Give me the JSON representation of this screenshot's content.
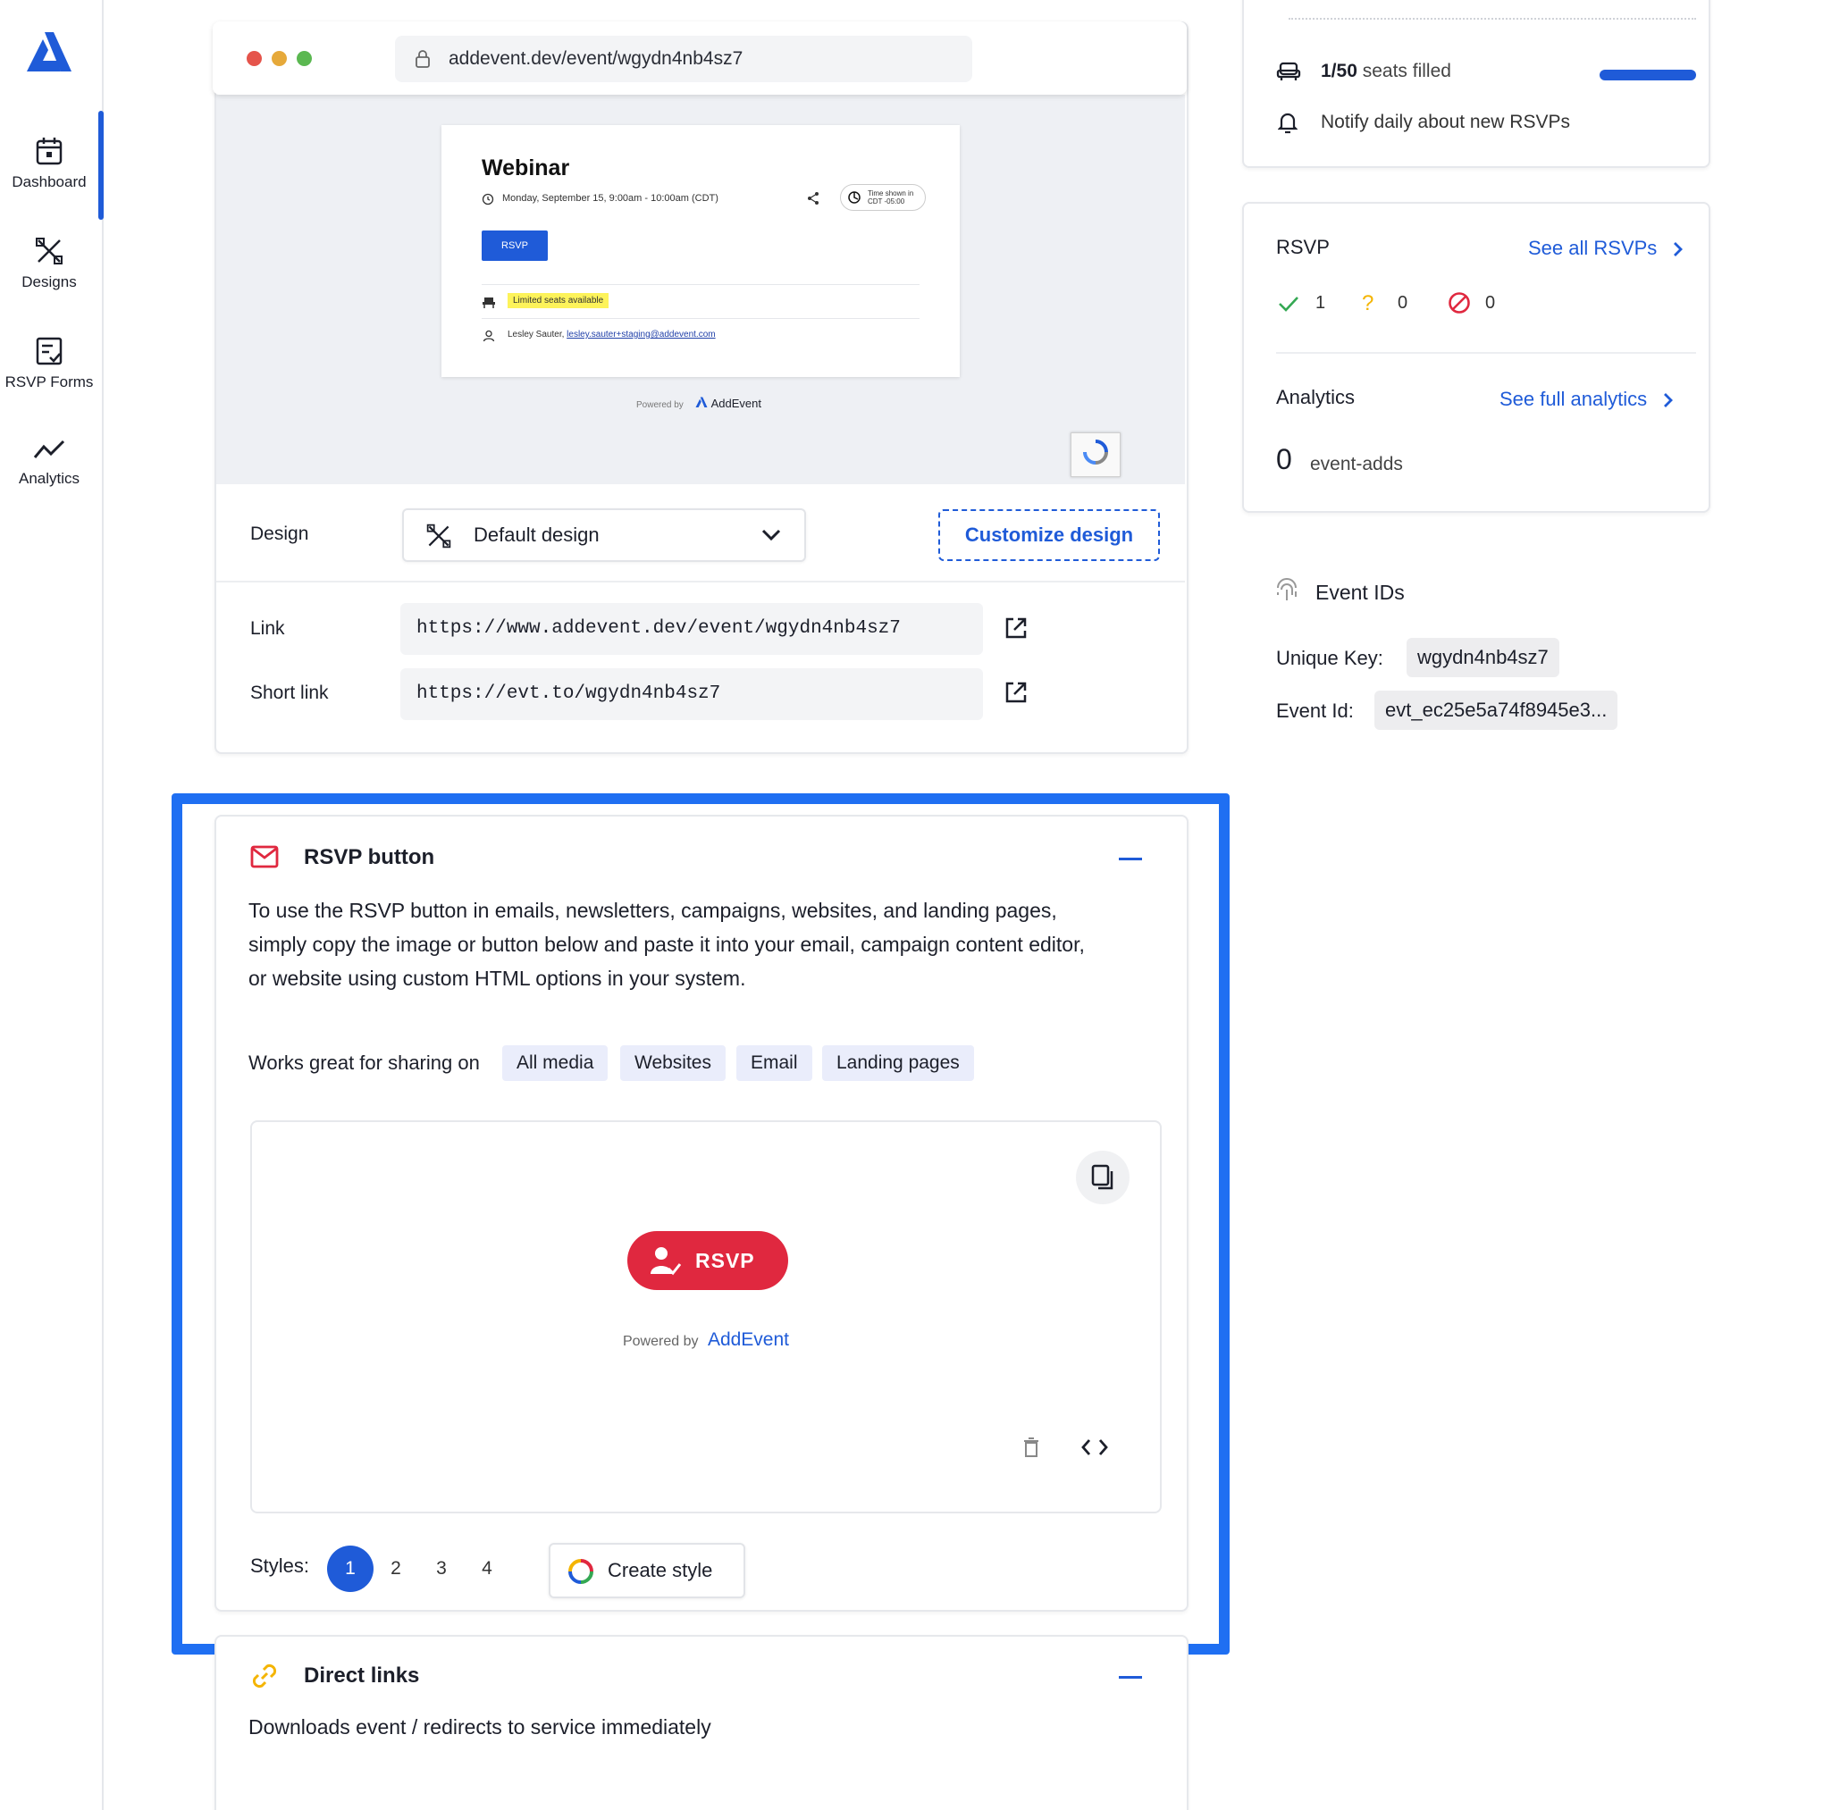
{
  "sidebar": {
    "items": [
      {
        "label": "Dashboard",
        "icon": "calendar-icon"
      },
      {
        "label": "Designs",
        "icon": "designs-icon"
      },
      {
        "label": "RSVP Forms",
        "icon": "form-icon"
      },
      {
        "label": "Analytics",
        "icon": "analytics-icon"
      }
    ]
  },
  "preview": {
    "url": "addevent.dev/event/wgydn4nb4sz7",
    "event_title": "Webinar",
    "event_date": "Monday, September 15, 9:00am - 10:00am (CDT)",
    "rsvp_label": "RSVP",
    "timezone_line1": "Time shown in",
    "timezone_line2": "CDT -05:00",
    "limited_seats": "Limited seats available",
    "host_name": "Lesley Sauter,",
    "host_email": "lesley.sauter+staging@addevent.com",
    "powered_by": "Powered by",
    "brand": "AddEvent"
  },
  "design": {
    "label": "Design",
    "selected": "Default design",
    "customize_label": "Customize design"
  },
  "links": {
    "link_label": "Link",
    "link_value": "https://www.addevent.dev/event/wgydn4nb4sz7",
    "short_label": "Short link",
    "short_value": "https://evt.to/wgydn4nb4sz7"
  },
  "rsvp_button": {
    "title": "RSVP button",
    "description_1": "To use the RSVP button in emails, newsletters, campaigns, websites, and landing pages,",
    "description_2": "simply copy the image or button below and paste it into your email, campaign content editor,",
    "description_3": "or website using custom HTML options in your system.",
    "sharing_label": "Works great for sharing on",
    "chips": [
      "All media",
      "Websites",
      "Email",
      "Landing pages"
    ],
    "button_label": "RSVP",
    "powered_by": "Powered by",
    "brand": "AddEvent",
    "styles_label": "Styles:",
    "styles": [
      "1",
      "2",
      "3",
      "4"
    ],
    "active_style": "1",
    "create_style_label": "Create style"
  },
  "direct_links": {
    "title": "Direct links",
    "description": "Downloads event / redirects to service immediately"
  },
  "seats": {
    "filled_strong": "1/50",
    "filled_rest": "seats filled",
    "fill_fraction": 0.02,
    "notify_label": "Notify daily about new RSVPs"
  },
  "rsvp_summary": {
    "title": "RSVP",
    "see_all": "See all RSVPs",
    "yes_count": "1",
    "maybe_count": "0",
    "no_count": "0"
  },
  "analytics": {
    "title": "Analytics",
    "see_full": "See full analytics",
    "count": "0",
    "count_label": "event-adds"
  },
  "event_ids": {
    "title": "Event IDs",
    "unique_key_label": "Unique Key:",
    "unique_key": "wgydn4nb4sz7",
    "event_id_label": "Event Id:",
    "event_id": "evt_ec25e5a74f8945e3..."
  },
  "colors": {
    "accent": "#1f5bd8",
    "rsvp_red": "#e0283f",
    "highlight": "#1f6ff2"
  }
}
